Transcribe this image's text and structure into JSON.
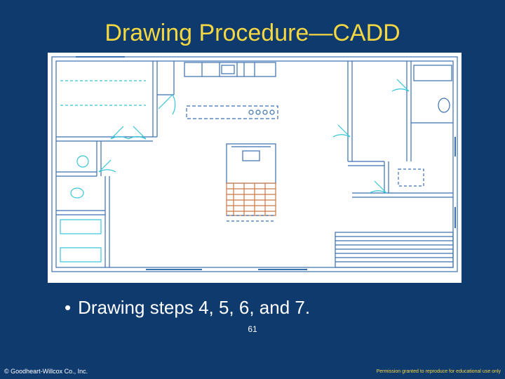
{
  "slide": {
    "title": "Drawing Procedure—CADD",
    "bullet": "Drawing steps 4, 5, 6, and 7.",
    "page_number": "61"
  },
  "footer": {
    "copyright": "© Goodheart-Willcox Co., Inc.",
    "permission": "Permission granted to reproduce for educational use only"
  }
}
